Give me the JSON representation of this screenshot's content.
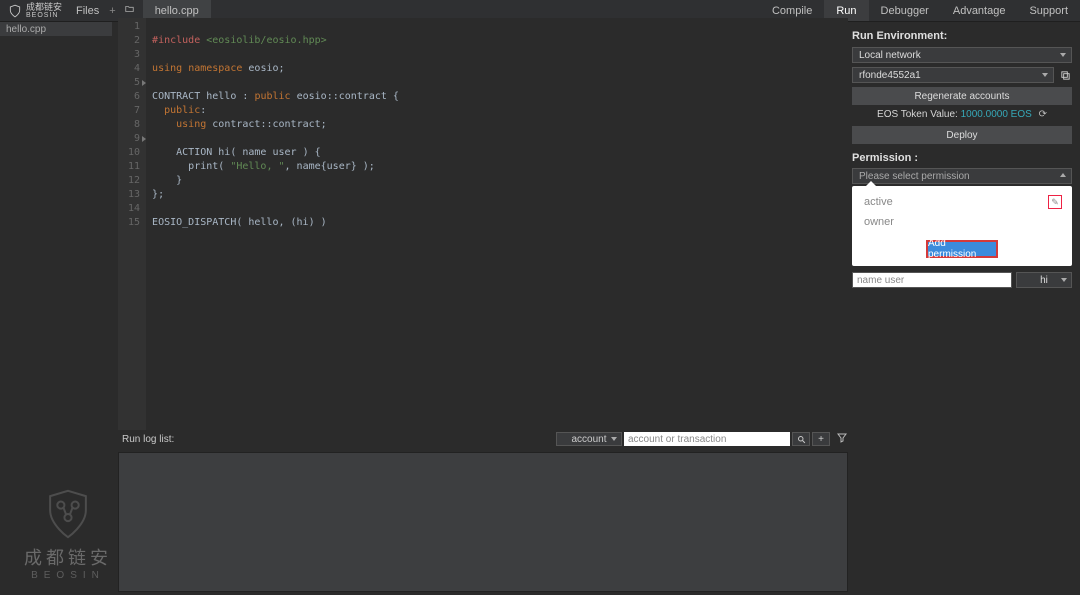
{
  "brand": {
    "cn": "成都链安",
    "en": "BEOSIN"
  },
  "topbar": {
    "files_label": "Files",
    "tab_label": "hello.cpp"
  },
  "menu": {
    "compile": "Compile",
    "run": "Run",
    "debugger": "Debugger",
    "advantage": "Advantage",
    "support": "Support"
  },
  "left": {
    "file_label": "hello.cpp"
  },
  "code": {
    "line1_inc": "#include",
    "line1_path": "<eosiolib/eosio.hpp>",
    "line3_a": "using",
    "line3_b": "namespace",
    "line3_c": "eosio;",
    "line5_a": "CONTRACT",
    "line5_b": "hello :",
    "line5_c": "public",
    "line5_d": "eosio::contract {",
    "line6_a": "public",
    "line6_b": ":",
    "line7_a": "using",
    "line7_b": "contract::contract;",
    "line9": "ACTION hi( name user ) {",
    "line10_a": "print(",
    "line10_b": "\"Hello, \"",
    "line10_c": ", name{user} );",
    "line11": "}",
    "line12": "};",
    "line14": "EOSIO_DISPATCH( hello, (hi) )"
  },
  "run_env": {
    "title": "Run Environment:",
    "network": "Local network",
    "account": "rfonde4552a1",
    "regen": "Regenerate accounts",
    "token_label": "EOS Token Value:",
    "token_value": "1000.0000 EOS",
    "deploy": "Deploy"
  },
  "permission": {
    "title": "Permission :",
    "placeholder": "Please select permission",
    "opt_active": "active",
    "opt_owner": "owner",
    "add_btn": "Add permission",
    "user_placeholder": "name user",
    "action": "hi"
  },
  "runlog": {
    "title": "Run log list:",
    "account_select": "account",
    "search_placeholder": "account or transaction"
  }
}
